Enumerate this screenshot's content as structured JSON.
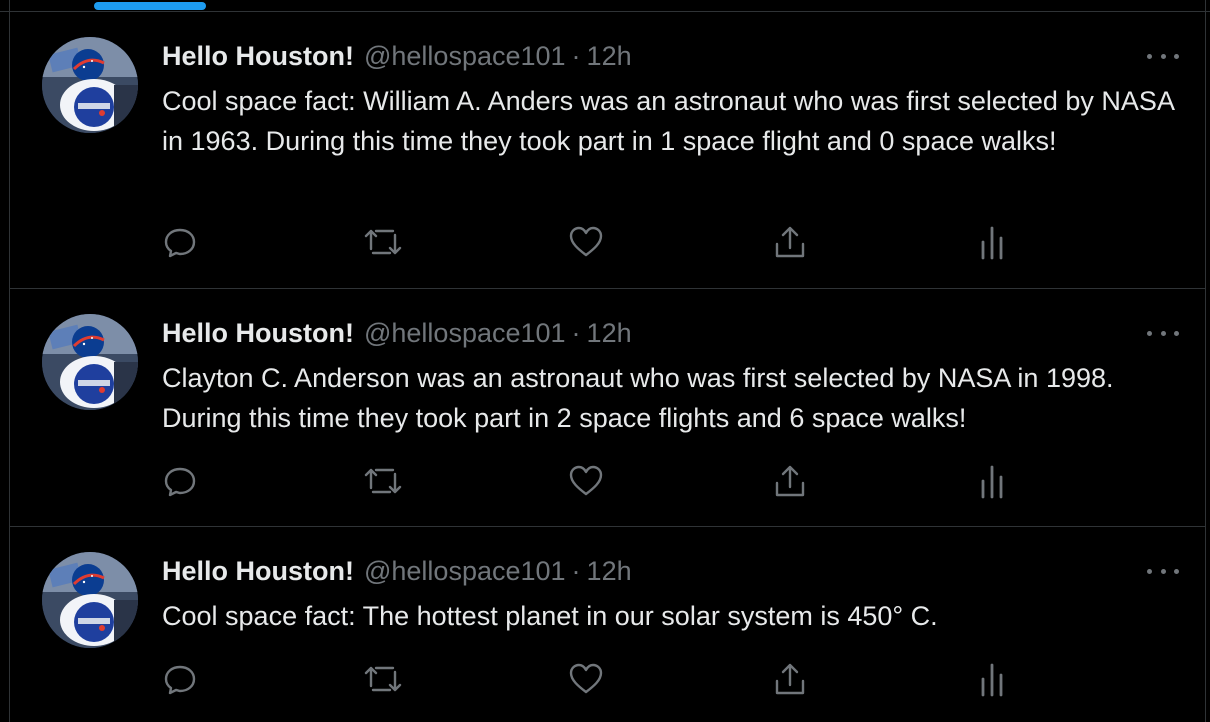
{
  "feed": {
    "tweets": [
      {
        "author_name": "Hello Houston!",
        "handle": "@hellospace101",
        "separator": "·",
        "time": "12h",
        "text": "Cool space fact: William A. Anders was an astronaut who was first selected by NASA in 1963. During this time they took part in 1 space flight and 0 space walks!",
        "avatar_icon": "nasa-iss-patch-avatar"
      },
      {
        "author_name": "Hello Houston!",
        "handle": "@hellospace101",
        "separator": "·",
        "time": "12h",
        "text": "Clayton C. Anderson was an astronaut who was first selected by NASA in 1998. During this time they took part in 2 space flights and 6 space walks!",
        "avatar_icon": "nasa-iss-patch-avatar"
      },
      {
        "author_name": "Hello Houston!",
        "handle": "@hellospace101",
        "separator": "·",
        "time": "12h",
        "text": "Cool space fact: The hottest planet in our solar system is 450° C.",
        "avatar_icon": "nasa-iss-patch-avatar"
      }
    ]
  },
  "icons": {
    "more": "more-horizontal-icon",
    "reply": "reply-bubble-icon",
    "retweet": "retweet-icon",
    "like": "heart-icon",
    "share": "share-upload-icon",
    "analytics": "analytics-bars-icon"
  },
  "colors": {
    "background": "#000000",
    "primary_text": "#e7e9ea",
    "secondary_text": "#71767b",
    "divider": "#2f3336",
    "accent": "#1d9bf0"
  }
}
